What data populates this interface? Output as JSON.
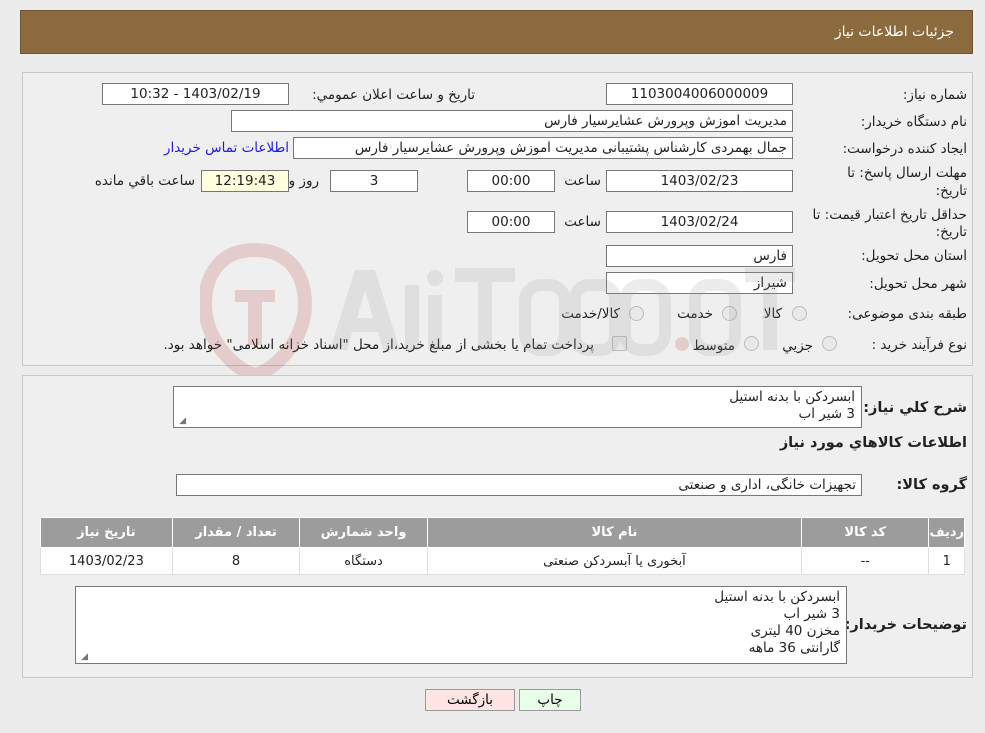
{
  "header": {
    "title": "جزئیات اطلاعات نیاز"
  },
  "form": {
    "need_number_label": "شماره نیاز:",
    "need_number": "1103004006000009",
    "announce_label": "تاریخ و ساعت اعلان عمومي:",
    "announce_value": "1403/02/19 - 10:32",
    "buyer_org_label": "نام دستگاه خريدار:",
    "buyer_org": "مديريت اموزش وپرورش عشايرسيار فارس",
    "creator_label": "ايجاد کننده درخواست:",
    "creator": "جمال بهمردی کارشناس پشتیبانی مدیریت اموزش وپرورش عشايرسيار فارس",
    "contact_link": "اطلاعات تماس خريدار",
    "reply_deadline_label_1": "مهلت ارسال پاسخ: تا",
    "reply_deadline_label_2": "تاريخ:",
    "reply_date": "1403/02/23",
    "time_label": "ساعت",
    "reply_time": "00:00",
    "days_value": "3",
    "days_label": "روز و",
    "remaining_time": "12:19:43",
    "remaining_label": "ساعت باقي مانده",
    "validity_label_1": "حداقل تاريخ اعتبار قيمت: تا",
    "validity_label_2": "تاريخ:",
    "validity_date": "1403/02/24",
    "validity_time": "00:00",
    "province_label": "استان محل تحويل:",
    "province": "فارس",
    "city_label": "شهر محل تحويل:",
    "city": "شيراز",
    "category_label": "طبقه بندی موضوعی:",
    "category_options": [
      "کالا",
      "خدمت",
      "کالا/خدمت"
    ],
    "process_label": "نوع فرآيند خريد :",
    "process_options": [
      "جزيي",
      "متوسط"
    ],
    "process_note": "پرداخت تمام يا بخشی از مبلغ خريد،از محل \"اسناد خزانه اسلامی\" خواهد بود."
  },
  "details": {
    "summary_label": "شرح کلي نياز:",
    "summary_lines": [
      "ابسردکن با بدنه استیل",
      "3 شیر اب"
    ],
    "goods_info_label": "اطلاعات کالاهاي مورد نياز",
    "group_label": "گروه کالا:",
    "group_value": "تجهيزات خانگی، اداری و صنعتی",
    "table": {
      "headers": [
        "رديف",
        "کد کالا",
        "نام کالا",
        "واحد شمارش",
        "تعداد / مقدار",
        "تاريخ نياز"
      ],
      "rows": [
        [
          "1",
          "--",
          "آبخوری یا آبسردکن صنعتی",
          "دستگاه",
          "8",
          "1403/02/23"
        ]
      ]
    },
    "buyer_notes_label": "توضيحات خريدار:",
    "buyer_notes_lines": [
      "ابسردکن با بدنه استیل",
      "3 شیر اب",
      "مخزن 40 لیتری",
      "گارانتی 36 ماهه"
    ]
  },
  "buttons": {
    "print": "چاپ",
    "back": "بازگشت"
  },
  "colors": {
    "header_bg": "#8b6a3e",
    "print_btn": "#eaffea",
    "back_btn": "#ffe4e4",
    "link": "#1a1aee"
  }
}
